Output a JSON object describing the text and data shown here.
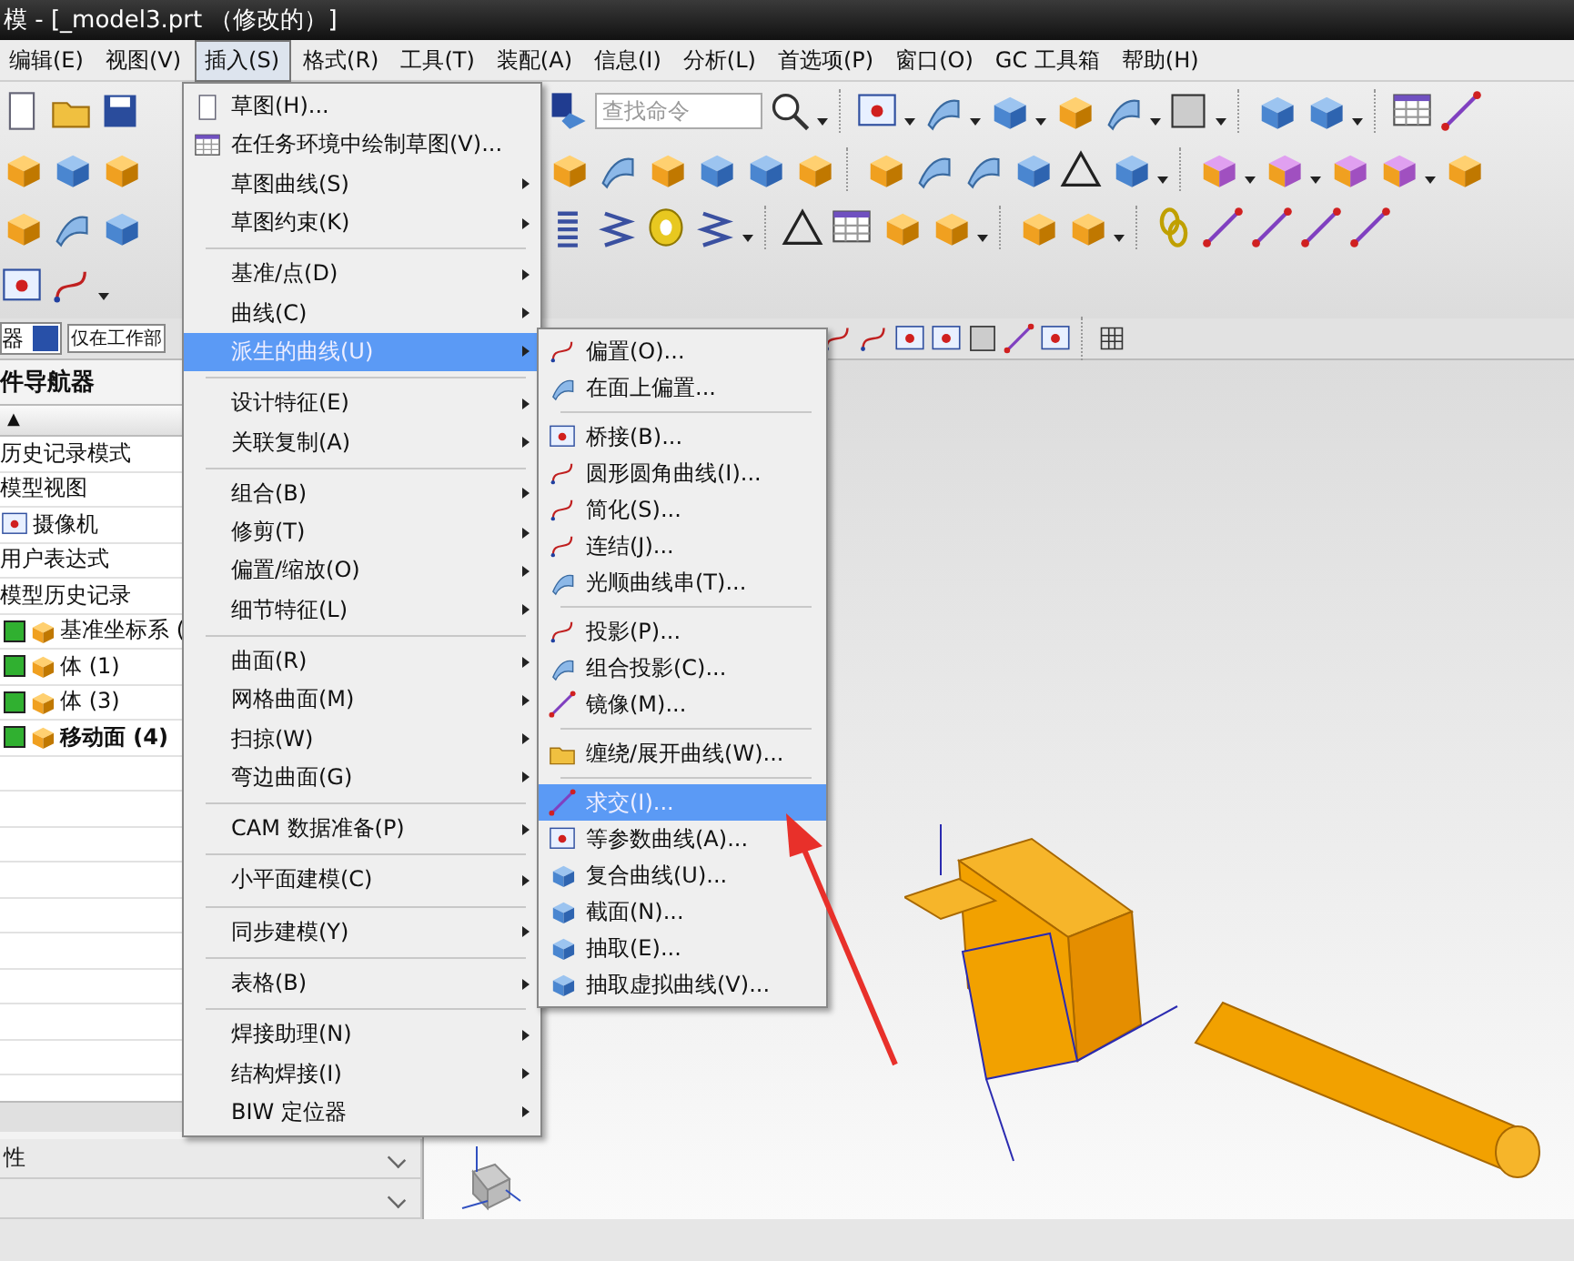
{
  "window": {
    "title": "模 - [_model3.prt （修改的）]"
  },
  "menubar": [
    {
      "label": "编辑(E)",
      "selected": false
    },
    {
      "label": "视图(V)",
      "selected": false
    },
    {
      "label": "插入(S)",
      "selected": true
    },
    {
      "label": "格式(R)",
      "selected": false
    },
    {
      "label": "工具(T)",
      "selected": false
    },
    {
      "label": "装配(A)",
      "selected": false
    },
    {
      "label": "信息(I)",
      "selected": false
    },
    {
      "label": "分析(L)",
      "selected": false
    },
    {
      "label": "首选项(P)",
      "selected": false
    },
    {
      "label": "窗口(O)",
      "selected": false
    },
    {
      "label": "GC 工具箱",
      "selected": false
    },
    {
      "label": "帮助(H)",
      "selected": false
    }
  ],
  "search": {
    "placeholder": "查找命令"
  },
  "selection_bar": {
    "filter": "器",
    "scope": "仅在工作部"
  },
  "navigator": {
    "title": "件导航器",
    "sort_mark": "▲",
    "items": [
      {
        "label": "历史记录模式"
      },
      {
        "label": "模型视图"
      },
      {
        "label": "摄像机"
      },
      {
        "label": "用户表达式"
      },
      {
        "label": "模型历史记录",
        "children": [
          {
            "label": "基准坐标系 (",
            "checked": true,
            "current": false
          },
          {
            "label": "体 (1)",
            "checked": true,
            "current": false
          },
          {
            "label": "体 (3)",
            "checked": true,
            "current": false
          },
          {
            "label": "移动面 (4)",
            "checked": true,
            "current": true
          }
        ]
      }
    ]
  },
  "details_panel": [
    {
      "label": "性",
      "expanded": false
    },
    {
      "expanded": false
    }
  ],
  "insert_menu": {
    "groups": [
      [
        {
          "label": "草图(H)...",
          "has_submenu": false,
          "selected": false
        },
        {
          "label": "在任务环境中绘制草图(V)...",
          "has_submenu": false,
          "selected": false
        },
        {
          "label": "草图曲线(S)",
          "has_submenu": true,
          "selected": false
        },
        {
          "label": "草图约束(K)",
          "has_submenu": true,
          "selected": false
        }
      ],
      [
        {
          "label": "基准/点(D)",
          "has_submenu": true,
          "selected": false
        },
        {
          "label": "曲线(C)",
          "has_submenu": true,
          "selected": false
        },
        {
          "label": "派生的曲线(U)",
          "has_submenu": true,
          "selected": true
        }
      ],
      [
        {
          "label": "设计特征(E)",
          "has_submenu": true,
          "selected": false
        },
        {
          "label": "关联复制(A)",
          "has_submenu": true,
          "selected": false
        }
      ],
      [
        {
          "label": "组合(B)",
          "has_submenu": true,
          "selected": false
        },
        {
          "label": "修剪(T)",
          "has_submenu": true,
          "selected": false
        },
        {
          "label": "偏置/缩放(O)",
          "has_submenu": true,
          "selected": false
        },
        {
          "label": "细节特征(L)",
          "has_submenu": true,
          "selected": false
        }
      ],
      [
        {
          "label": "曲面(R)",
          "has_submenu": true,
          "selected": false
        },
        {
          "label": "网格曲面(M)",
          "has_submenu": true,
          "selected": false
        },
        {
          "label": "扫掠(W)",
          "has_submenu": true,
          "selected": false
        },
        {
          "label": "弯边曲面(G)",
          "has_submenu": true,
          "selected": false
        }
      ],
      [
        {
          "label": "CAM 数据准备(P)",
          "has_submenu": true,
          "selected": false
        }
      ],
      [
        {
          "label": "小平面建模(C)",
          "has_submenu": true,
          "selected": false
        }
      ],
      [
        {
          "label": "同步建模(Y)",
          "has_submenu": true,
          "selected": false
        }
      ],
      [
        {
          "label": "表格(B)",
          "has_submenu": true,
          "selected": false
        }
      ],
      [
        {
          "label": "焊接助理(N)",
          "has_submenu": true,
          "selected": false
        },
        {
          "label": "结构焊接(I)",
          "has_submenu": true,
          "selected": false
        },
        {
          "label": "BIW 定位器",
          "has_submenu": true,
          "selected": false
        }
      ]
    ]
  },
  "derived_curve_menu": {
    "groups": [
      [
        {
          "label": "偏置(O)...",
          "selected": false
        },
        {
          "label": "在面上偏置...",
          "selected": false
        }
      ],
      [
        {
          "label": "桥接(B)...",
          "selected": false
        },
        {
          "label": "圆形圆角曲线(I)...",
          "selected": false
        },
        {
          "label": "简化(S)...",
          "selected": false
        },
        {
          "label": "连结(J)...",
          "selected": false
        },
        {
          "label": "光顺曲线串(T)...",
          "selected": false
        }
      ],
      [
        {
          "label": "投影(P)...",
          "selected": false
        },
        {
          "label": "组合投影(C)...",
          "selected": false
        },
        {
          "label": "镜像(M)...",
          "selected": false
        }
      ],
      [
        {
          "label": "缠绕/展开曲线(W)...",
          "selected": false
        }
      ],
      [
        {
          "label": "求交(I)...",
          "selected": true
        },
        {
          "label": "等参数曲线(A)...",
          "selected": false
        },
        {
          "label": "复合曲线(U)...",
          "selected": false
        },
        {
          "label": "截面(N)...",
          "selected": false
        },
        {
          "label": "抽取(E)...",
          "selected": false
        },
        {
          "label": "抽取虚拟曲线(V)...",
          "selected": false
        }
      ]
    ]
  }
}
